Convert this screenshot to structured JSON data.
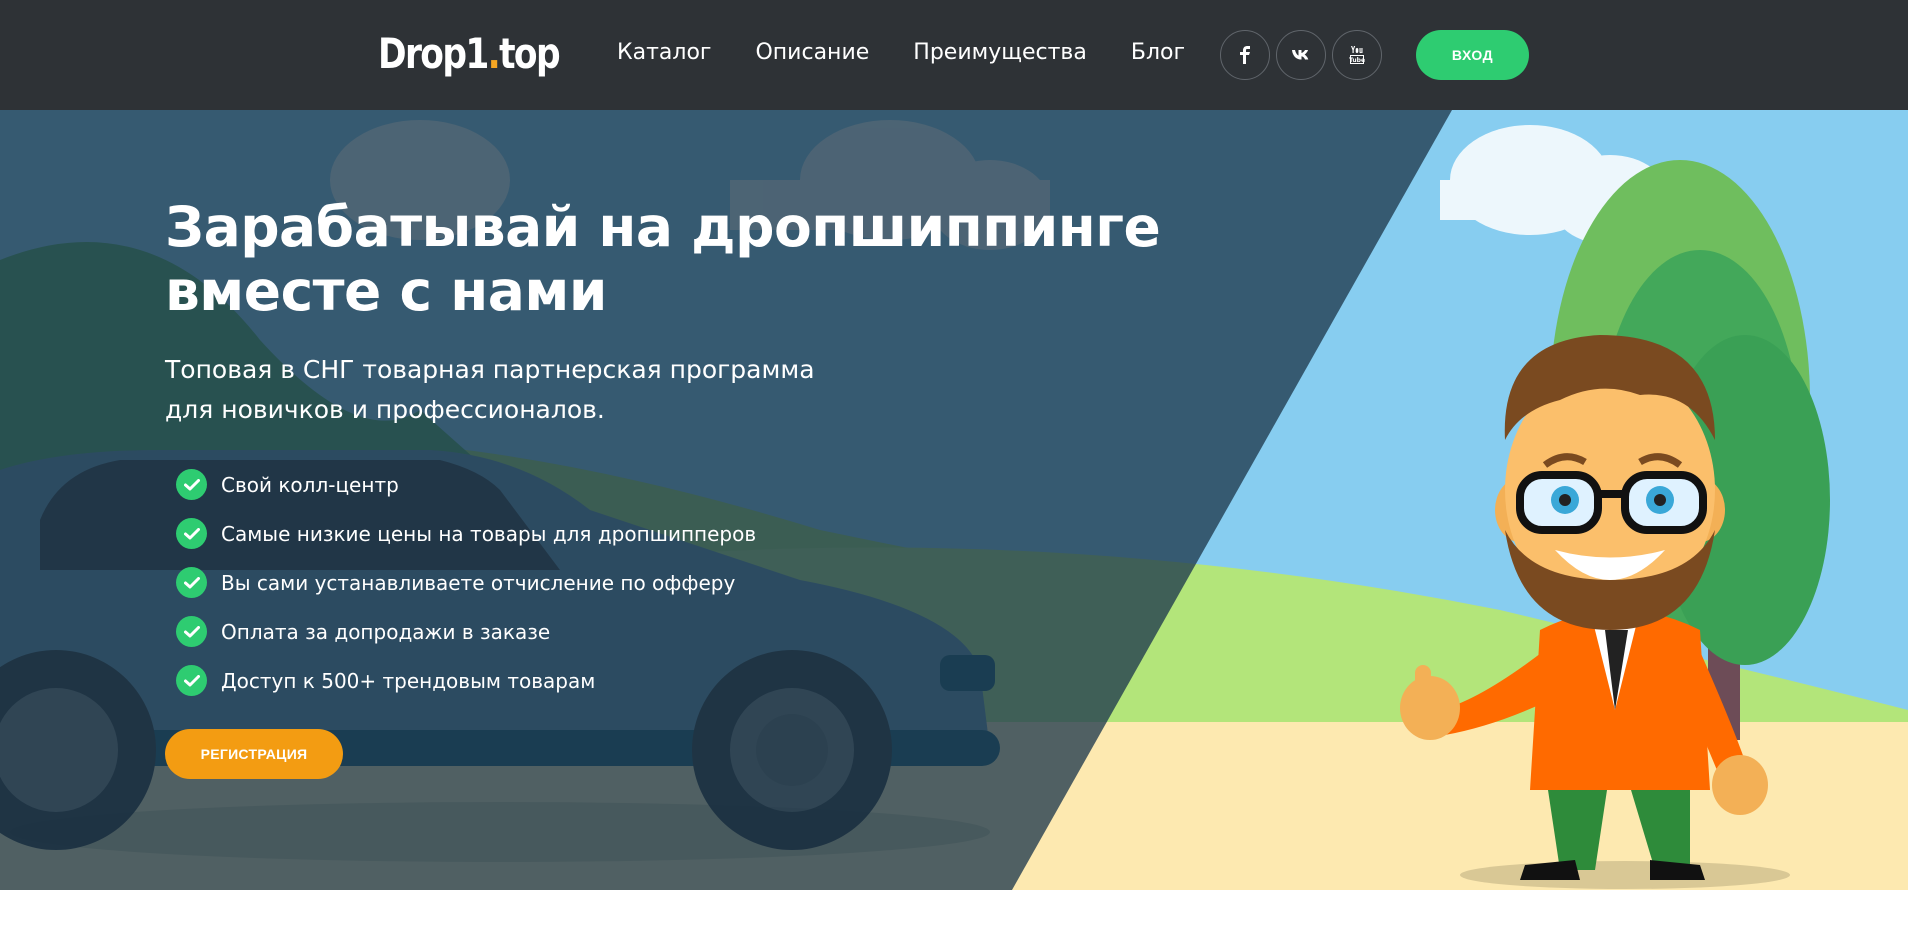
{
  "header": {
    "logo_main": "Drop1",
    "logo_dot": ".",
    "logo_tld": "top",
    "nav": [
      "Каталог",
      "Описание",
      "Преимущества",
      "Блог"
    ],
    "social": [
      {
        "name": "facebook-icon",
        "glyph": "f"
      },
      {
        "name": "vk-icon",
        "glyph": "vk"
      },
      {
        "name": "youtube-icon",
        "glyph": "You"
      }
    ],
    "login_label": "ВХОД"
  },
  "hero": {
    "title_line1": "Зарабатывай на дропшиппинге",
    "title_line2": "вместе с нами",
    "subtitle_line1": "Топовая в СНГ товарная партнерская программа",
    "subtitle_line2": "для новичков и профессионалов.",
    "features": [
      "Свой колл-центр",
      "Самые низкие цены на товары для дропшипперов",
      "Вы сами устанавливаете отчисление по офферу",
      "Оплата за допродажи в заказе",
      "Доступ к 500+ трендовым товарам"
    ],
    "register_label": "РЕГИСТРАЦИЯ"
  },
  "colors": {
    "header_bg": "#2e3236",
    "accent_green": "#2ecc71",
    "accent_orange": "#f39c12",
    "logo_dot": "#f5a623",
    "overlay": "#1f3a4d"
  }
}
